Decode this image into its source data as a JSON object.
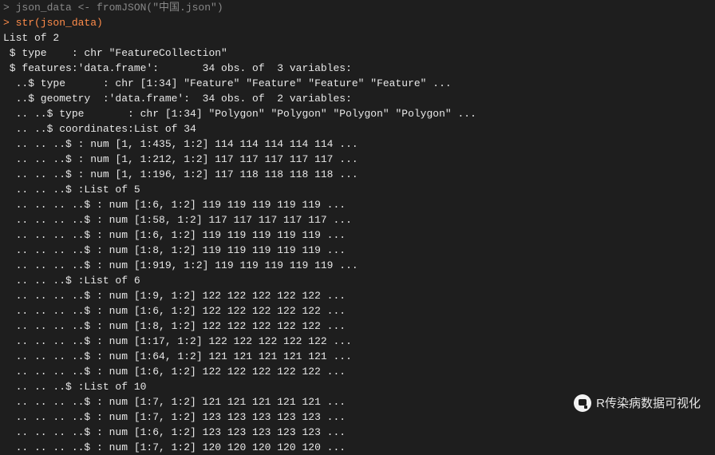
{
  "command_line_partial": "> json_data <- fromJSON(\"中国.json\")",
  "command": "> str(json_data)",
  "output_lines": [
    "List of 2",
    " $ type    : chr \"FeatureCollection\"",
    " $ features:'data.frame':       34 obs. of  3 variables:",
    "  ..$ type      : chr [1:34] \"Feature\" \"Feature\" \"Feature\" \"Feature\" ...",
    "  ..$ geometry  :'data.frame':  34 obs. of  2 variables:",
    "  .. ..$ type       : chr [1:34] \"Polygon\" \"Polygon\" \"Polygon\" \"Polygon\" ...",
    "  .. ..$ coordinates:List of 34",
    "  .. .. ..$ : num [1, 1:435, 1:2] 114 114 114 114 114 ...",
    "  .. .. ..$ : num [1, 1:212, 1:2] 117 117 117 117 117 ...",
    "  .. .. ..$ : num [1, 1:196, 1:2] 117 118 118 118 118 ...",
    "  .. .. ..$ :List of 5",
    "  .. .. .. ..$ : num [1:6, 1:2] 119 119 119 119 119 ...",
    "  .. .. .. ..$ : num [1:58, 1:2] 117 117 117 117 117 ...",
    "  .. .. .. ..$ : num [1:6, 1:2] 119 119 119 119 119 ...",
    "  .. .. .. ..$ : num [1:8, 1:2] 119 119 119 119 119 ...",
    "  .. .. .. ..$ : num [1:919, 1:2] 119 119 119 119 119 ...",
    "  .. .. ..$ :List of 6",
    "  .. .. .. ..$ : num [1:9, 1:2] 122 122 122 122 122 ...",
    "  .. .. .. ..$ : num [1:6, 1:2] 122 122 122 122 122 ...",
    "  .. .. .. ..$ : num [1:8, 1:2] 122 122 122 122 122 ...",
    "  .. .. .. ..$ : num [1:17, 1:2] 122 122 122 122 122 ...",
    "  .. .. .. ..$ : num [1:64, 1:2] 121 121 121 121 121 ...",
    "  .. .. .. ..$ : num [1:6, 1:2] 122 122 122 122 122 ...",
    "  .. .. ..$ :List of 10",
    "  .. .. .. ..$ : num [1:7, 1:2] 121 121 121 121 121 ...",
    "  .. .. .. ..$ : num [1:7, 1:2] 123 123 123 123 123 ...",
    "  .. .. .. ..$ : num [1:6, 1:2] 123 123 123 123 123 ...",
    "  .. .. .. ..$ : num [1:7, 1:2] 120 120 120 120 120 ..."
  ],
  "watermark": {
    "text": "R传染病数据可视化"
  }
}
